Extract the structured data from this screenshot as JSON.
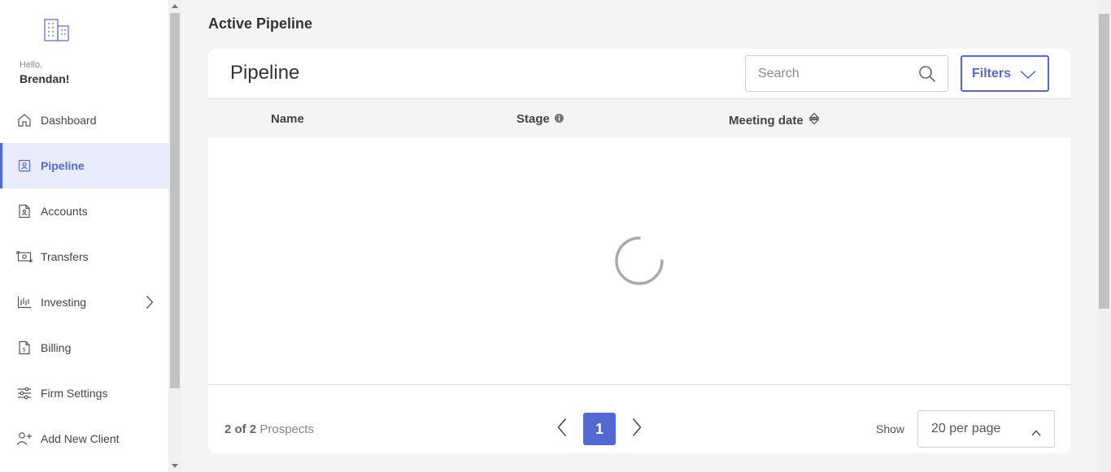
{
  "sidebar": {
    "greeting": "Hello,",
    "user_name": "Brendan!",
    "items": [
      {
        "label": "Dashboard",
        "icon": "home-icon"
      },
      {
        "label": "Pipeline",
        "icon": "contact-card-icon",
        "active": true
      },
      {
        "label": "Accounts",
        "icon": "document-icon"
      },
      {
        "label": "Transfers",
        "icon": "money-transfer-icon"
      },
      {
        "label": "Investing",
        "icon": "investing-chart-icon",
        "has_submenu": true
      },
      {
        "label": "Billing",
        "icon": "invoice-icon"
      },
      {
        "label": "Firm Settings",
        "icon": "sliders-icon"
      },
      {
        "label": "Add New Client",
        "icon": "add-user-icon"
      }
    ]
  },
  "page": {
    "title": "Active Pipeline"
  },
  "card": {
    "title": "Pipeline",
    "search_placeholder": "Search",
    "filters_label": "Filters"
  },
  "table": {
    "columns": [
      "Name",
      "Stage",
      "Meeting date"
    ],
    "loading": true
  },
  "footer": {
    "count_text": "2 of 2",
    "count_suffix": "Prospects",
    "current_page": "1",
    "show_label": "Show",
    "per_page": "20 per page"
  },
  "colors": {
    "accent": "#5468d4",
    "active_bg": "#e8ebfa",
    "page_bg": "#f4f4f4"
  }
}
